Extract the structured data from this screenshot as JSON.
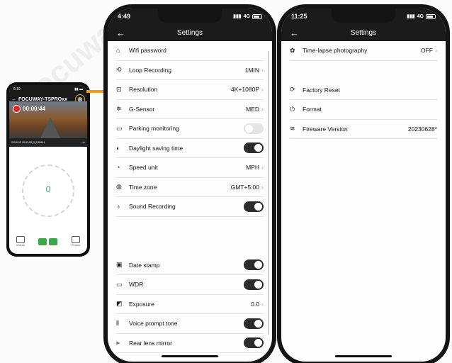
{
  "small_phone": {
    "time": "6:19",
    "device_name": "FOCUWAY-TSPROxx",
    "rec_time": "00:00:44",
    "info_bar": "2024/1/3 10:03:09 [1] 0 KM/H",
    "speed": "0",
    "speed_unit": "KM/H",
    "bottom_left_label": "Videos",
    "bottom_right_label": "Photos"
  },
  "phone1": {
    "time": "4:49",
    "network": "4G",
    "title": "Settings",
    "rows": [
      {
        "label": "Wifi password",
        "value": "",
        "type": "plain",
        "icon": "wifi-icon",
        "glyph": "⌂"
      },
      {
        "label": "Loop Recording",
        "value": "1MIN",
        "type": "chevron",
        "icon": "loop-icon",
        "glyph": "⟲"
      },
      {
        "label": "Resolution",
        "value": "4K+1080P",
        "type": "chevron",
        "icon": "resolution-icon",
        "glyph": "⊡"
      },
      {
        "label": "G-Sensor",
        "value": "MED",
        "type": "chevron",
        "icon": "g-sensor-icon",
        "glyph": "≑"
      },
      {
        "label": "Parking monitoring",
        "value": "",
        "type": "toggle-off",
        "icon": "parking-icon",
        "glyph": "▭"
      },
      {
        "label": "Daylight saving time",
        "value": "",
        "type": "toggle-on",
        "icon": "daylight-icon",
        "glyph": "◐"
      },
      {
        "label": "Speed unit",
        "value": "MPH",
        "type": "chevron",
        "icon": "speed-icon",
        "glyph": "◔"
      },
      {
        "label": "Time zone",
        "value": "GMT+5:00",
        "type": "chevron",
        "icon": "globe-icon",
        "glyph": "◍"
      },
      {
        "label": "Sound Recording",
        "value": "",
        "type": "toggle-on",
        "icon": "microphone-icon",
        "glyph": "♁"
      }
    ],
    "rows2": [
      {
        "label": "Date stamp",
        "value": "",
        "type": "toggle-on",
        "icon": "date-stamp-icon",
        "glyph": "▣"
      },
      {
        "label": "WDR",
        "value": "",
        "type": "toggle-on",
        "icon": "wdr-icon",
        "glyph": "▭"
      },
      {
        "label": "Exposure",
        "value": "0.0",
        "type": "chevron",
        "icon": "exposure-icon",
        "glyph": "◩"
      },
      {
        "label": "Voice prompt tone",
        "value": "",
        "type": "toggle-on",
        "icon": "voice-icon",
        "glyph": "⦀"
      },
      {
        "label": "Rear lens mirror",
        "value": "",
        "type": "toggle-on",
        "icon": "mirror-icon",
        "glyph": "⫸"
      }
    ]
  },
  "phone2": {
    "time": "11:25",
    "network": "4G",
    "title": "Settings",
    "rows": [
      {
        "label": "Time-lapse photography",
        "value": "OFF",
        "type": "chevron",
        "icon": "time-lapse-icon",
        "glyph": "✿"
      }
    ],
    "rows2": [
      {
        "label": "Factory Reset",
        "value": "",
        "type": "plain",
        "icon": "reset-icon",
        "glyph": "⟳"
      },
      {
        "label": "Format",
        "value": "",
        "type": "plain",
        "icon": "power-icon",
        "glyph": "⏻"
      },
      {
        "label": "Fireware Version",
        "value": "20230628*",
        "type": "plain",
        "icon": "layers-icon",
        "glyph": "≋"
      }
    ]
  },
  "watermark": "Focuway"
}
